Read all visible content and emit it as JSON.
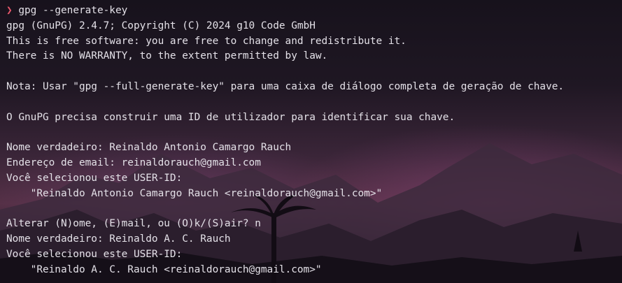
{
  "prompt": {
    "symbol": "❯",
    "command": "gpg --generate-key"
  },
  "output": [
    "gpg (GnuPG) 2.4.7; Copyright (C) 2024 g10 Code GmbH",
    "This is free software: you are free to change and redistribute it.",
    "There is NO WARRANTY, to the extent permitted by law.",
    "",
    "Nota: Usar \"gpg --full-generate-key\" para uma caixa de diálogo completa de geração de chave.",
    "",
    "O GnuPG precisa construir uma ID de utilizador para identificar sua chave.",
    "",
    "Nome verdadeiro: Reinaldo Antonio Camargo Rauch",
    "Endereço de email: reinaldorauch@gmail.com",
    "Você selecionou este USER-ID:",
    "    \"Reinaldo Antonio Camargo Rauch <reinaldorauch@gmail.com>\"",
    "",
    "Alterar (N)ome, (E)mail, ou (O)k/(S)air? n",
    "Nome verdadeiro: Reinaldo A. C. Rauch",
    "Você selecionou este USER-ID:",
    "    \"Reinaldo A. C. Rauch <reinaldorauch@gmail.com>\""
  ],
  "colors": {
    "prompt_arrow": "#e8576b",
    "text": "#e4e1e8",
    "background": "#1b1620"
  }
}
